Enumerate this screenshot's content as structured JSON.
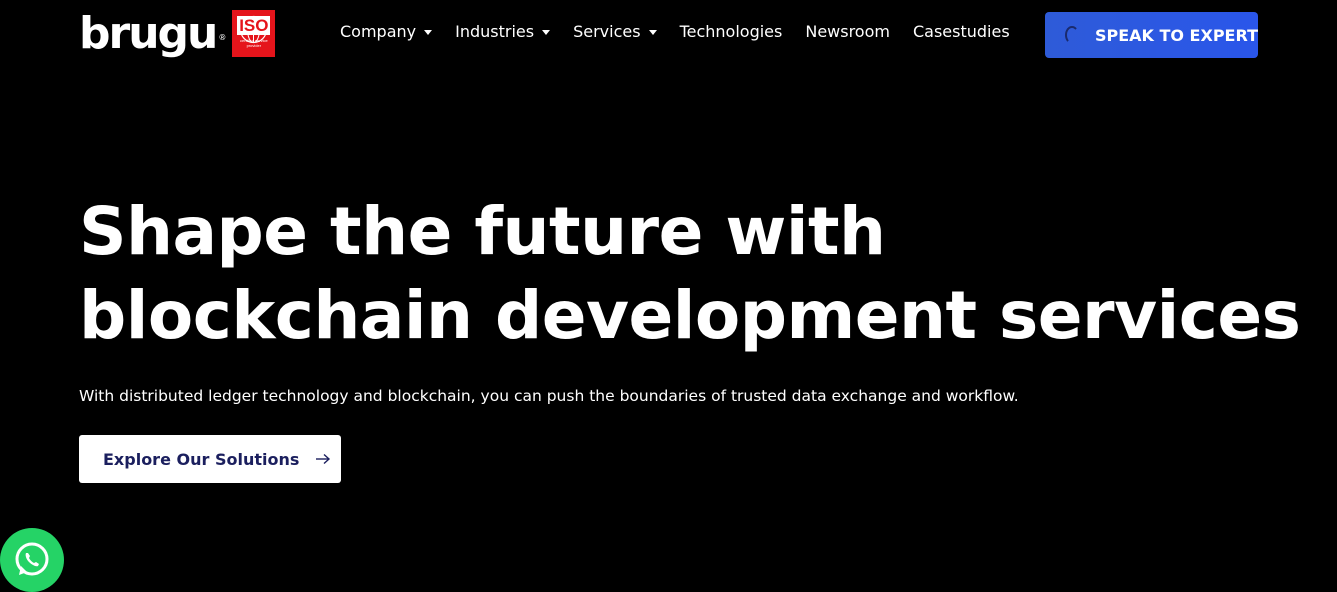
{
  "brand": {
    "logo_text": "brugu",
    "registered_mark": "®",
    "iso_label": "ISO",
    "iso_subtext": "certified service provider"
  },
  "nav": {
    "items": [
      {
        "label": "Company",
        "has_dropdown": true
      },
      {
        "label": "Industries",
        "has_dropdown": true
      },
      {
        "label": "Services",
        "has_dropdown": true
      },
      {
        "label": "Technologies",
        "has_dropdown": false
      },
      {
        "label": "Newsroom",
        "has_dropdown": false
      },
      {
        "label": "Casestudies",
        "has_dropdown": false
      }
    ],
    "cta_label": "SPEAK TO EXPERT"
  },
  "hero": {
    "title_line1": "Shape the future with",
    "title_line2": "blockchain development services",
    "subtitle": "With distributed ledger technology and blockchain, you can push the boundaries of trusted data exchange and workflow.",
    "button_label": "Explore Our Solutions"
  },
  "icons": {
    "chevron": "chevron-down-icon",
    "arrow": "arrow-right-icon",
    "spinner": "loading-spinner-icon",
    "whatsapp": "whatsapp-icon"
  },
  "colors": {
    "background": "#000000",
    "cta_blue": "#2a56ea",
    "iso_red": "#e5141b",
    "button_text_navy": "#1b1f5e",
    "whatsapp_green": "#25d366"
  }
}
